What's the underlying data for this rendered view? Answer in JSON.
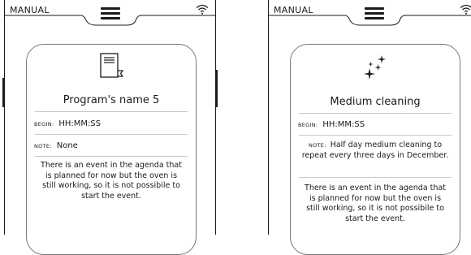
{
  "screens": [
    {
      "mode": "MANUAL",
      "icon": "book-icon",
      "title": "Program's name 5",
      "begin_label": "BEGIN:",
      "begin_value": "HH:MM:SS",
      "note_label": "NOTE:",
      "note_value": "None",
      "message": "There is an event in the agenda that is planned for now but the oven is still working, so it is not possibile to start the event."
    },
    {
      "mode": "MANUAL",
      "icon": "sparkles-icon",
      "title": "Medium cleaning",
      "begin_label": "BEGIN:",
      "begin_value": "HH:MM:SS",
      "note_label": "NOTE:",
      "note_value": "Half day medium cleaning to repeat every three days in December.",
      "message": "There is an event in the agenda that is planned for now but the oven is still working, so it is not possibile to start the event."
    }
  ]
}
